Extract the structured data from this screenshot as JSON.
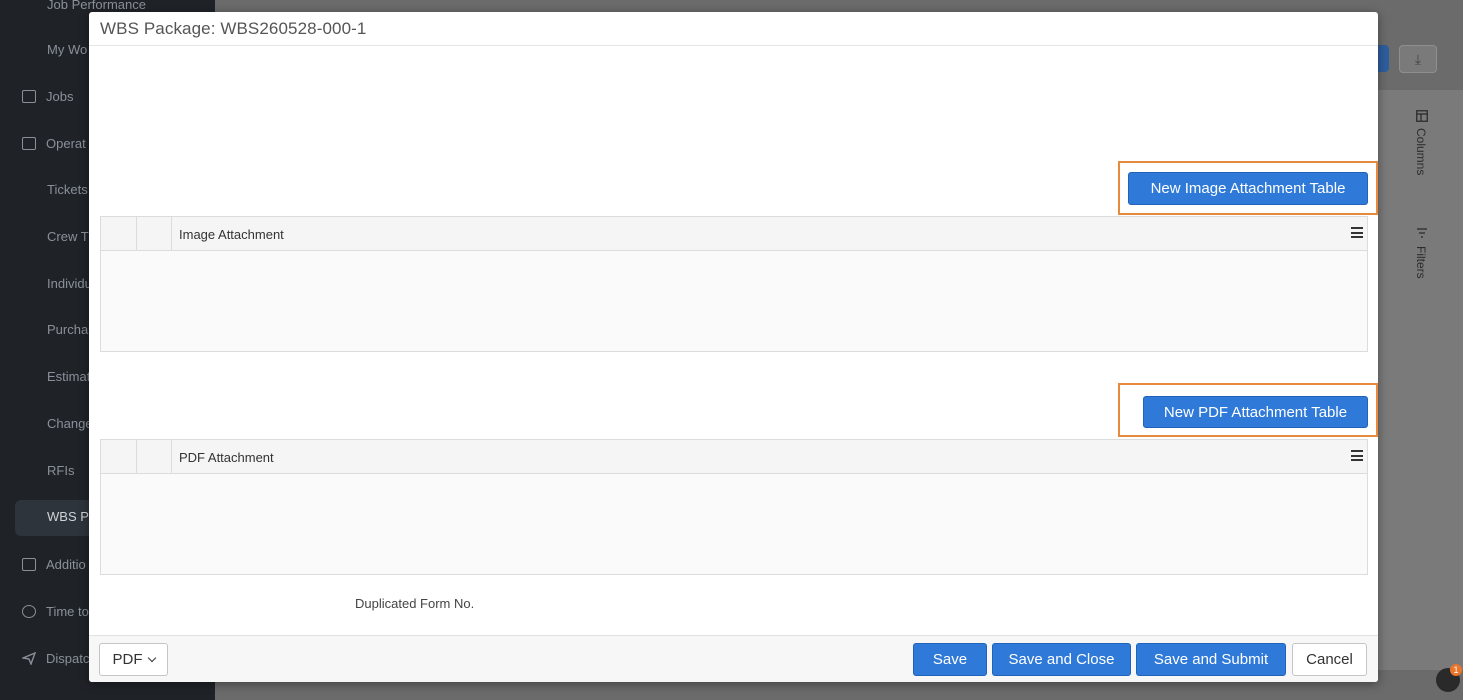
{
  "background": {
    "sidebar_items": [
      {
        "label": "Job Performance"
      },
      {
        "label": "My Wo"
      },
      {
        "label": "Jobs"
      },
      {
        "label": "Operat"
      },
      {
        "label": "Tickets"
      },
      {
        "label": "Crew Ti"
      },
      {
        "label": "Individu"
      },
      {
        "label": "Purcha"
      },
      {
        "label": "Estimat"
      },
      {
        "label": "Change"
      },
      {
        "label": "RFIs"
      },
      {
        "label": "WBS Pa"
      },
      {
        "label": "Additio"
      },
      {
        "label": "Time to"
      },
      {
        "label": "Dispatc"
      }
    ],
    "side_panel": {
      "columns_label": "Columns",
      "filters_label": "Filters"
    },
    "download_icon": "download-icon",
    "notification_count": "1"
  },
  "modal": {
    "title": "WBS Package: WBS260528-000-1",
    "image_section": {
      "button_label": "New Image Attachment Table",
      "grid_title": "Image Attachment"
    },
    "pdf_section": {
      "button_label": "New PDF Attachment Table",
      "grid_title": "PDF Attachment"
    },
    "duplicated_form_label": "Duplicated Form No.",
    "footer": {
      "pdf_label": "PDF",
      "save_label": "Save",
      "save_close_label": "Save and Close",
      "save_submit_label": "Save and Submit",
      "cancel_label": "Cancel"
    },
    "accent_color": "#2f7ad8",
    "highlight_color": "#e58a3f"
  }
}
